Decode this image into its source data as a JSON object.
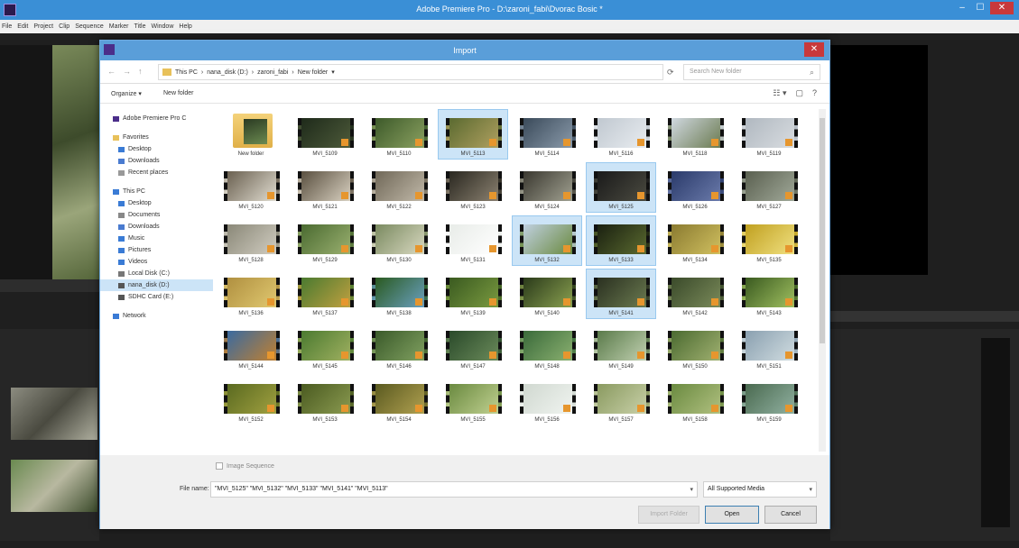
{
  "app": {
    "title": "Adobe Premiere Pro - D:\\zaroni_fabi\\Dvorac Bosic *",
    "minimize": "–",
    "maximize": "☐",
    "close": "✕"
  },
  "menu": [
    "File",
    "Edit",
    "Project",
    "Clip",
    "Sequence",
    "Marker",
    "Title",
    "Window",
    "Help"
  ],
  "dialog": {
    "title": "Import",
    "close": "✕",
    "nav": {
      "back": "←",
      "forward": "→",
      "up": "↑"
    },
    "breadcrumb": [
      "This PC",
      "›",
      "nana_disk (D:)",
      "›",
      "zaroni_fabi",
      "›",
      "New folder",
      "▾"
    ],
    "refresh": "⟳",
    "search_placeholder": "Search New folder",
    "search_icon": "⌕",
    "toolbar": {
      "organize": "Organize ▾",
      "new_folder": "New folder"
    },
    "view_icons": [
      "☷ ▾",
      "▢",
      "?"
    ],
    "nav_pane": [
      {
        "label": "Adobe Premiere Pro C",
        "color": "#4b2e8a",
        "sub": false,
        "selected": false
      },
      {
        "gap": true
      },
      {
        "label": "Favorites",
        "color": "#e8c15a",
        "sub": false,
        "selected": false
      },
      {
        "label": "Desktop",
        "color": "#3a7bd5",
        "sub": true,
        "selected": false
      },
      {
        "label": "Downloads",
        "color": "#4a7bd0",
        "sub": true,
        "selected": false
      },
      {
        "label": "Recent places",
        "color": "#999999",
        "sub": true,
        "selected": false
      },
      {
        "gap": true
      },
      {
        "label": "This PC",
        "color": "#3a7bd5",
        "sub": false,
        "selected": false
      },
      {
        "label": "Desktop",
        "color": "#3a7bd5",
        "sub": true,
        "selected": false
      },
      {
        "label": "Documents",
        "color": "#888888",
        "sub": true,
        "selected": false
      },
      {
        "label": "Downloads",
        "color": "#4a7bd0",
        "sub": true,
        "selected": false
      },
      {
        "label": "Music",
        "color": "#3a7bd5",
        "sub": true,
        "selected": false
      },
      {
        "label": "Pictures",
        "color": "#3a7bd5",
        "sub": true,
        "selected": false
      },
      {
        "label": "Videos",
        "color": "#3a7bd5",
        "sub": true,
        "selected": false
      },
      {
        "label": "Local Disk (C:)",
        "color": "#777777",
        "sub": true,
        "selected": false
      },
      {
        "label": "nana_disk (D:)",
        "color": "#555555",
        "sub": true,
        "selected": true
      },
      {
        "label": "SDHC Card (E:)",
        "color": "#555555",
        "sub": true,
        "selected": false
      },
      {
        "gap": true
      },
      {
        "label": "Network",
        "color": "#3a7bd5",
        "sub": false,
        "selected": false
      }
    ],
    "files": [
      {
        "name": "New folder",
        "folder": true
      },
      {
        "name": "MVI_5109",
        "colors": [
          "#1e2a1a",
          "#4d5a3a"
        ]
      },
      {
        "name": "MVI_5110",
        "colors": [
          "#3d5a2a",
          "#8aa060"
        ]
      },
      {
        "name": "MVI_5113",
        "selected": true,
        "colors": [
          "#5a6a30",
          "#b0a060"
        ]
      },
      {
        "name": "MVI_5114",
        "colors": [
          "#3a4a5a",
          "#8a9aaa"
        ]
      },
      {
        "name": "MVI_5116",
        "colors": [
          "#c0c8d0",
          "#e8ecf0"
        ]
      },
      {
        "name": "MVI_5118",
        "colors": [
          "#d0d8e0",
          "#6a7a50"
        ]
      },
      {
        "name": "MVI_5119",
        "colors": [
          "#b0b8c0",
          "#d8dce0"
        ]
      },
      {
        "name": "MVI_5120",
        "colors": [
          "#6a6050",
          "#e0dcd0"
        ]
      },
      {
        "name": "MVI_5121",
        "colors": [
          "#5a5040",
          "#d8d0c0"
        ]
      },
      {
        "name": "MVI_5122",
        "colors": [
          "#706858",
          "#c0b8a8"
        ]
      },
      {
        "name": "MVI_5123",
        "colors": [
          "#2a2820",
          "#8a8070"
        ]
      },
      {
        "name": "MVI_5124",
        "colors": [
          "#3a3830",
          "#a0a090"
        ]
      },
      {
        "name": "MVI_5125",
        "selected": true,
        "colors": [
          "#1a1a1a",
          "#4a4a40"
        ]
      },
      {
        "name": "MVI_5126",
        "colors": [
          "#2a3a6a",
          "#6a7aaa"
        ]
      },
      {
        "name": "MVI_5127",
        "colors": [
          "#5a6050",
          "#a0a898"
        ]
      },
      {
        "name": "MVI_5128",
        "colors": [
          "#8a8878",
          "#d0ccc0"
        ]
      },
      {
        "name": "MVI_5129",
        "colors": [
          "#4a6a30",
          "#9ab070"
        ]
      },
      {
        "name": "MVI_5130",
        "colors": [
          "#7a8a60",
          "#d8d8c0"
        ]
      },
      {
        "name": "MVI_5131",
        "colors": [
          "#e8ece8",
          "#ffffff"
        ]
      },
      {
        "name": "MVI_5132",
        "selected": true,
        "colors": [
          "#c0d0e0",
          "#6a8a40"
        ]
      },
      {
        "name": "MVI_5133",
        "selected": true,
        "colors": [
          "#1a2010",
          "#5a6a30"
        ]
      },
      {
        "name": "MVI_5134",
        "colors": [
          "#8a7a30",
          "#d0c060"
        ]
      },
      {
        "name": "MVI_5135",
        "colors": [
          "#c0a020",
          "#f0e080"
        ]
      },
      {
        "name": "MVI_5136",
        "colors": [
          "#b09040",
          "#e0c870"
        ]
      },
      {
        "name": "MVI_5137",
        "colors": [
          "#4a7a30",
          "#c0a040"
        ]
      },
      {
        "name": "MVI_5138",
        "colors": [
          "#2a5a20",
          "#6aa0c0"
        ]
      },
      {
        "name": "MVI_5139",
        "colors": [
          "#3a5a20",
          "#7a9a40"
        ]
      },
      {
        "name": "MVI_5140",
        "colors": [
          "#2a3a1a",
          "#8aa050"
        ]
      },
      {
        "name": "MVI_5141",
        "selected": true,
        "colors": [
          "#2a3020",
          "#6a7a50"
        ]
      },
      {
        "name": "MVI_5142",
        "colors": [
          "#3a4a2a",
          "#7a8a5a"
        ]
      },
      {
        "name": "MVI_5143",
        "colors": [
          "#3a5a20",
          "#a0c060"
        ]
      },
      {
        "name": "MVI_5144",
        "colors": [
          "#3a6aa0",
          "#c08030"
        ]
      },
      {
        "name": "MVI_5145",
        "colors": [
          "#4a7a30",
          "#a0b060"
        ]
      },
      {
        "name": "MVI_5146",
        "colors": [
          "#3a5a2a",
          "#80a060"
        ]
      },
      {
        "name": "MVI_5147",
        "colors": [
          "#2a4a2a",
          "#6a8a5a"
        ]
      },
      {
        "name": "MVI_5148",
        "colors": [
          "#3a6a3a",
          "#8ab070"
        ]
      },
      {
        "name": "MVI_5149",
        "colors": [
          "#5a7a4a",
          "#c0d0b0"
        ]
      },
      {
        "name": "MVI_5150",
        "colors": [
          "#4a6a30",
          "#a0b070"
        ]
      },
      {
        "name": "MVI_5151",
        "colors": [
          "#8aa0b0",
          "#d0dce0"
        ]
      },
      {
        "name": "MVI_5152",
        "colors": [
          "#5a6a20",
          "#a0a040"
        ]
      },
      {
        "name": "MVI_5153",
        "colors": [
          "#4a5a20",
          "#8a9a50"
        ]
      },
      {
        "name": "MVI_5154",
        "colors": [
          "#5a5a20",
          "#b0a050"
        ]
      },
      {
        "name": "MVI_5155",
        "colors": [
          "#6a8a40",
          "#c0d090"
        ]
      },
      {
        "name": "MVI_5156",
        "colors": [
          "#d0d8d0",
          "#f0f4f0"
        ]
      },
      {
        "name": "MVI_5157",
        "colors": [
          "#8a9a60",
          "#c8d0a8"
        ]
      },
      {
        "name": "MVI_5158",
        "colors": [
          "#6a8a40",
          "#b0c080"
        ]
      },
      {
        "name": "MVI_5159",
        "colors": [
          "#4a6a50",
          "#90b0a0"
        ]
      }
    ],
    "image_sequence_label": "Image Sequence",
    "file_name_label": "File name:",
    "file_name_value": "\"MVI_5125\" \"MVI_5132\" \"MVI_5133\" \"MVI_5141\" \"MVI_5113\"",
    "file_type_value": "All Supported Media",
    "dropdown_arrow": "▾",
    "buttons": {
      "import_folder": "Import Folder",
      "open": "Open",
      "cancel": "Cancel"
    }
  }
}
